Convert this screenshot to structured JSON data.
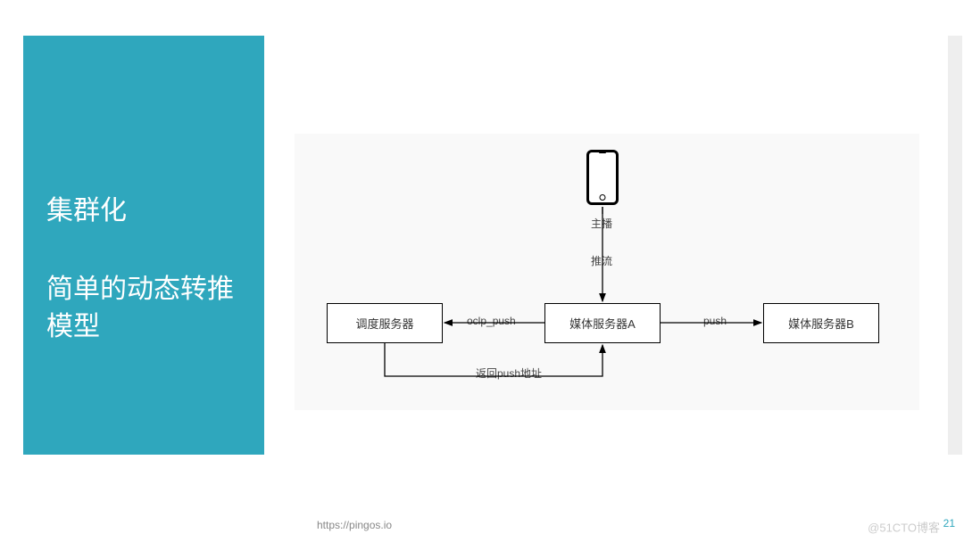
{
  "sidebar": {
    "title": "集群化",
    "subtitle": "简单的动态转推模型"
  },
  "diagram": {
    "hostLabel": "主播",
    "pushStreamLabel": "推流",
    "dispatchServer": "调度服务器",
    "mediaServerA": "媒体服务器A",
    "mediaServerB": "媒体服务器B",
    "oclpPushLabel": "oclp_push",
    "pushLabel": "push",
    "returnLabel": "返回push地址"
  },
  "footer": {
    "url": "https://pingos.io",
    "watermark": "@51CTO博客",
    "pageNumber": "21"
  },
  "chart_data": {
    "type": "diagram",
    "title": "集群化 — 简单的动态转推模型",
    "nodes": [
      {
        "id": "host",
        "label": "主播",
        "kind": "client-device"
      },
      {
        "id": "dispatch",
        "label": "调度服务器",
        "kind": "server"
      },
      {
        "id": "mediaA",
        "label": "媒体服务器A",
        "kind": "server"
      },
      {
        "id": "mediaB",
        "label": "媒体服务器B",
        "kind": "server"
      }
    ],
    "edges": [
      {
        "from": "host",
        "to": "mediaA",
        "label": "推流",
        "direction": "one-way"
      },
      {
        "from": "mediaA",
        "to": "dispatch",
        "label": "oclp_push",
        "direction": "one-way"
      },
      {
        "from": "dispatch",
        "to": "mediaA",
        "label": "返回push地址",
        "direction": "one-way"
      },
      {
        "from": "mediaA",
        "to": "mediaB",
        "label": "push",
        "direction": "one-way"
      }
    ]
  }
}
